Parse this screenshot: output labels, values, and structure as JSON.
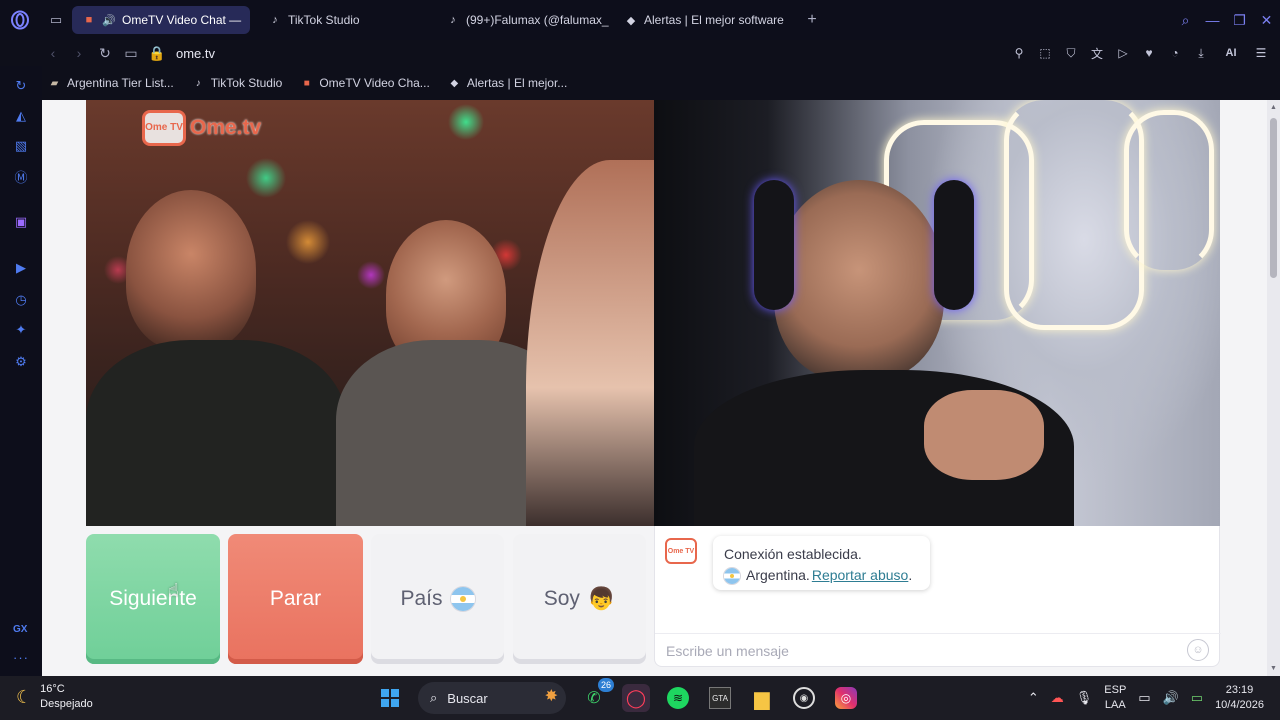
{
  "browser": {
    "tabs": [
      {
        "label": "OmeTV Video Chat — ",
        "icon": "ometv-favicon",
        "active": true
      },
      {
        "label": "TikTok Studio",
        "icon": "tiktok-icon",
        "active": false
      },
      {
        "label": "(99+)Falumax (@falumax_",
        "icon": "tiktok-icon",
        "active": false
      },
      {
        "label": "Alertas | El mejor software",
        "icon": "streamelements-icon",
        "active": false
      }
    ],
    "url": "ome.tv",
    "ai_label": "AI",
    "bookmarks": [
      {
        "label": "Argentina Tier List...",
        "icon": "bookmark-folder-icon"
      },
      {
        "label": "TikTok Studio",
        "icon": "tiktok-icon"
      },
      {
        "label": "OmeTV Video Cha...",
        "icon": "ometv-favicon"
      },
      {
        "label": "Alertas | El mejor...",
        "icon": "streamelements-icon"
      }
    ],
    "sidebar_gx": "GX",
    "sidebar_more": "···"
  },
  "page": {
    "logo_badge": "Ome TV",
    "logo_text": "Ome.tv",
    "buttons": {
      "next": "Siguiente",
      "stop": "Parar",
      "country": "País",
      "gender": "Soy"
    },
    "chat": {
      "logo_badge": "Ome TV",
      "status": "Conexión establecida.",
      "country": "Argentina.",
      "report": "Reportar abuso",
      "report_suffix": ".",
      "placeholder": "Escribe un mensaje"
    }
  },
  "taskbar": {
    "temperature": "16°C",
    "condition": "Despejado",
    "search": "Buscar",
    "whatsapp_badge": "26",
    "lang_top": "ESP",
    "lang_bottom": "LAA",
    "time": "23:19",
    "date": "10/4/2026"
  },
  "colors": {
    "accent_next": "#6fcf98",
    "accent_stop": "#e9725f",
    "brand_ometv": "#e8674c",
    "opera_active_tab": "#272a58"
  }
}
